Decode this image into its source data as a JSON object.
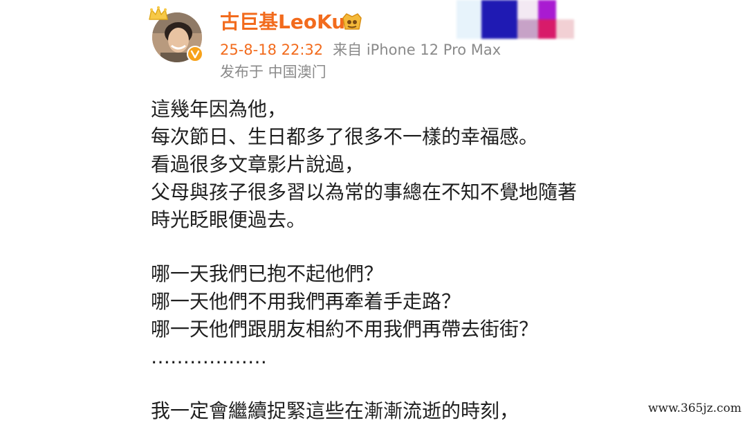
{
  "post": {
    "username": "古巨基LeoKu",
    "date": "25-8-18 22:32",
    "source": "来自 iPhone 12 Pro Max",
    "location": "发布于 中国澳门",
    "paragraphs": [
      [
        "這幾年因為他，",
        "每次節日、生日都多了很多不一樣的幸福感。",
        "看過很多文章影片說過，",
        "父母與孩子很多習以為常的事總在不知不覺地隨著",
        "時光眨眼便過去。"
      ],
      [
        "哪一天我們已抱不起他們？",
        "哪一天他們不用我們再牽着手走路？",
        "哪一天他們跟朋友相約不用我們再帶去街街？",
        "………………"
      ],
      [
        "我一定會繼續捉緊這些在漸漸流逝的時刻，"
      ]
    ]
  },
  "icons": {
    "crown": "crown-icon",
    "verified": "verified-badge-icon",
    "vip": "vip-badge-icon"
  },
  "colors": {
    "username": "#f26b1d",
    "meta": "#8a8a8a",
    "text": "#1f1f1f"
  },
  "watermark": "www.365jz.com"
}
